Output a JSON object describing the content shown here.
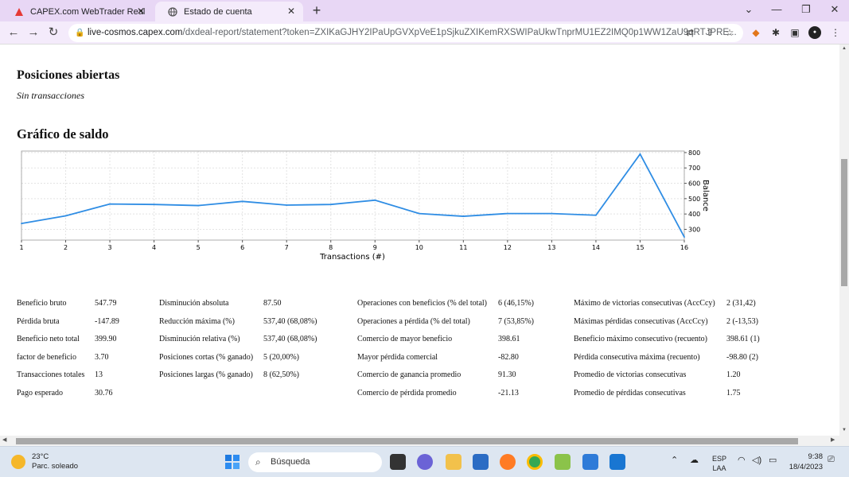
{
  "browser": {
    "tabs": [
      {
        "title": "CAPEX.com WebTrader Real",
        "active": false,
        "favicon": "capex-logo-icon"
      },
      {
        "title": "Estado de cuenta",
        "active": true,
        "favicon": "globe-icon"
      }
    ],
    "url_host": "live-cosmos.capex.com",
    "url_path": "/dxdeal-report/statement?token=ZXIKaGJHY2IPaUpGVXpVeE1pSjkuZXIKemRXSWIPaUkwTnprMU1EZ2IMQ0p1WW1ZaU9qRTJPRE..."
  },
  "page": {
    "open_positions_title": "Posiciones abiertas",
    "open_positions_empty": "Sin transacciones",
    "balance_chart_title": "Gráfico de saldo"
  },
  "chart_data": {
    "type": "line",
    "title": "",
    "xlabel": "Transactions (#)",
    "ylabel": "Balance",
    "x": [
      1,
      2,
      3,
      4,
      5,
      6,
      7,
      8,
      9,
      10,
      11,
      12,
      13,
      14,
      15,
      16
    ],
    "series": [
      {
        "name": "",
        "values": [
          338,
          388,
          465,
          462,
          455,
          482,
          458,
          462,
          490,
          403,
          385,
          403,
          403,
          392,
          790,
          250
        ]
      }
    ],
    "xlim": [
      1,
      16
    ],
    "ylim": [
      230,
      810
    ],
    "yticks": [
      300,
      400,
      500,
      600,
      700,
      800
    ],
    "grid": true,
    "line_color": "#2f8de4"
  },
  "stats": {
    "col1": [
      {
        "label": "Beneficio bruto",
        "value": "547.79"
      },
      {
        "label": "Pérdida bruta",
        "value": "-147.89"
      },
      {
        "label": "Beneficio neto total",
        "value": "399.90"
      },
      {
        "label": "factor de beneficio",
        "value": "3.70"
      },
      {
        "label": "Transacciones totales",
        "value": "13"
      },
      {
        "label": "Pago esperado",
        "value": "30.76"
      }
    ],
    "col2": [
      {
        "label": "Disminución absoluta",
        "value": "87.50"
      },
      {
        "label": "Reducción máxima (%)",
        "value": "537,40 (68,08%)"
      },
      {
        "label": "Disminución relativa (%)",
        "value": "537,40 (68,08%)"
      },
      {
        "label": "Posiciones cortas (% ganado)",
        "value": "5 (20,00%)"
      },
      {
        "label": "Posiciones largas (% ganado)",
        "value": "8 (62,50%)"
      }
    ],
    "col3": [
      {
        "label": "Operaciones con beneficios (% del total)",
        "value": "6 (46,15%)"
      },
      {
        "label": "Operaciones a pérdida (% del total)",
        "value": "7 (53,85%)"
      },
      {
        "label": "Comercio de mayor beneficio",
        "value": "398.61"
      },
      {
        "label": "Mayor pérdida comercial",
        "value": "-82.80"
      },
      {
        "label": "Comercio de ganancia promedio",
        "value": "91.30"
      },
      {
        "label": "Comercio de pérdida promedio",
        "value": "-21.13"
      }
    ],
    "col4": [
      {
        "label": "Máximo de victorias consecutivas (AccCcy)",
        "value": "2 (31,42)"
      },
      {
        "label": "Máximas pérdidas consecutivas (AccCcy)",
        "value": "2 (-13,53)"
      },
      {
        "label": "Beneficio máximo consecutivo (recuento)",
        "value": "398.61 (1)"
      },
      {
        "label": "Pérdida consecutiva máxima (recuento)",
        "value": "-98.80 (2)"
      },
      {
        "label": "Promedio de victorias consecutivas",
        "value": "1.20"
      },
      {
        "label": "Promedio de pérdidas consecutivas",
        "value": "1.75"
      }
    ]
  },
  "taskbar": {
    "weather_temp": "23°C",
    "weather_desc": "Parc. soleado",
    "search_placeholder": "Búsqueda",
    "lang_top": "ESP",
    "lang_bottom": "LAA",
    "time": "9:38",
    "date": "18/4/2023"
  }
}
